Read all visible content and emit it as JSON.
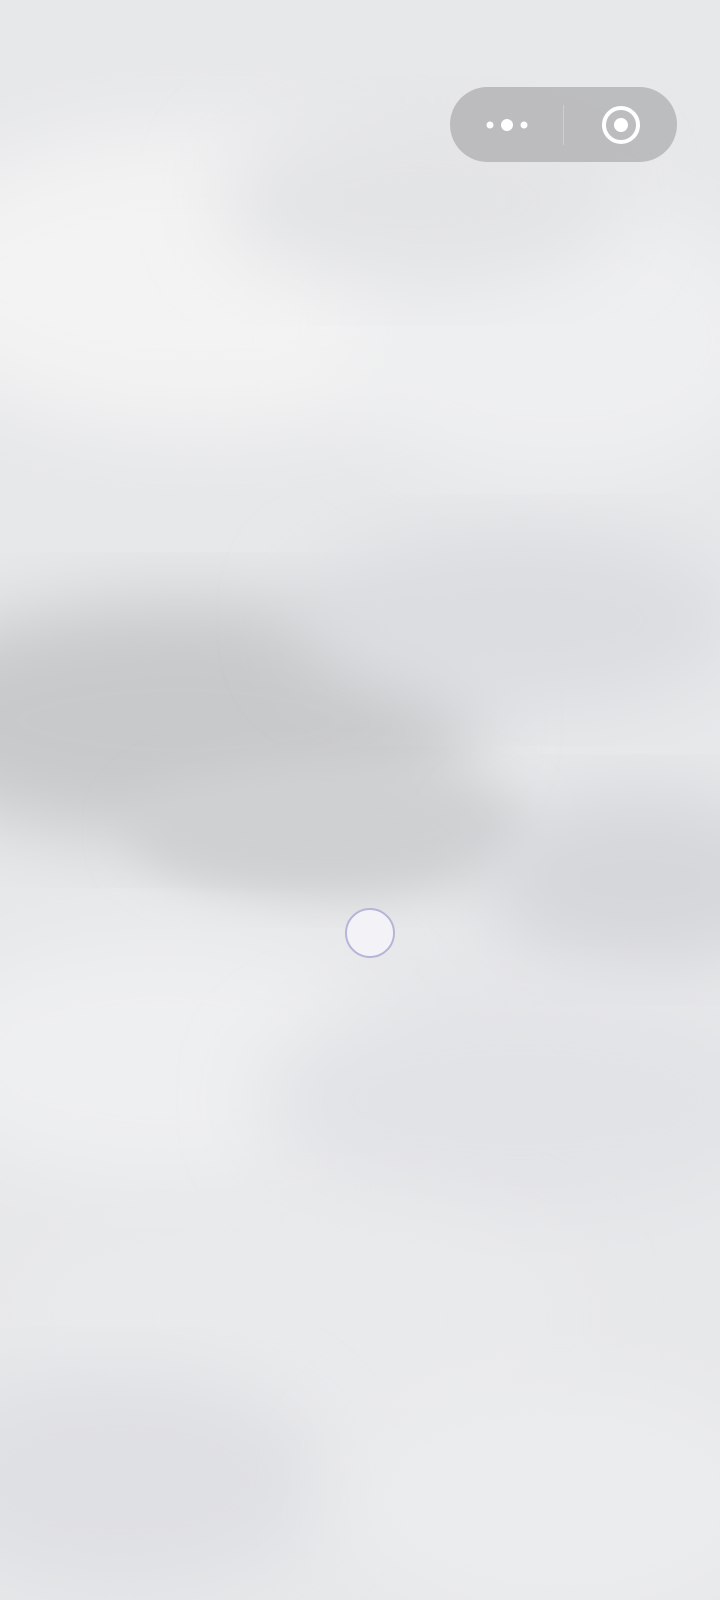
{
  "capsule": {
    "more_icon": "more-dots-icon",
    "close_icon": "target-close-icon",
    "background_color": "#acacae",
    "icon_color": "#ffffff"
  },
  "camera_view": {
    "description_icon": "blurred-camera-feed",
    "tint_color": "#e6e7e9"
  },
  "loading_indicator": {
    "icon": "loading-circle-icon",
    "ring_color": "#b6b4d8"
  }
}
